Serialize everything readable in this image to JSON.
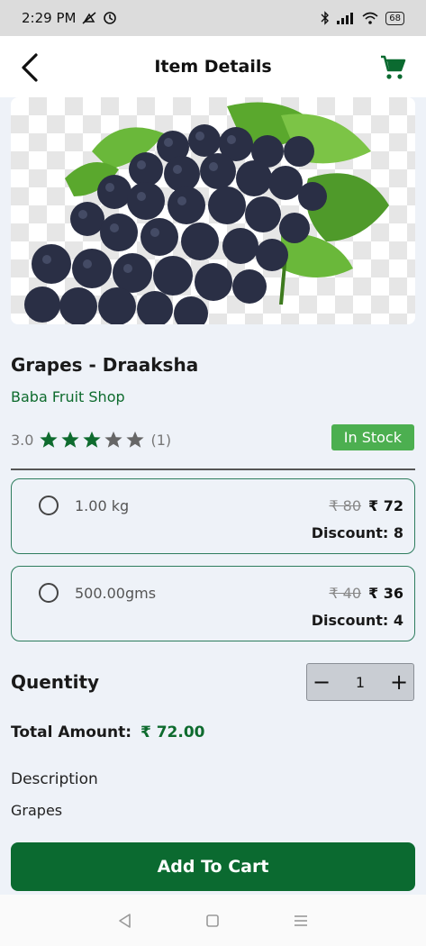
{
  "status_bar": {
    "time": "2:29 PM",
    "battery": "68"
  },
  "header": {
    "title": "Item Details"
  },
  "product": {
    "name": "Grapes - Draaksha",
    "shop": "Baba Fruit Shop",
    "rating": "3.0",
    "stars_filled": 3,
    "stars_total": 5,
    "review_count": "(1)",
    "stock_status": "In Stock"
  },
  "options": [
    {
      "weight": "1.00 kg",
      "old_price": "₹ 80",
      "new_price": "₹ 72",
      "discount": "Discount: 8"
    },
    {
      "weight": "500.00gms",
      "old_price": "₹ 40",
      "new_price": "₹ 36",
      "discount": "Discount: 4"
    }
  ],
  "quantity": {
    "label": "Quentity",
    "value": "1",
    "minus": "−",
    "plus": "+"
  },
  "total": {
    "label": "Total Amount:",
    "amount": "₹ 72.00"
  },
  "description": {
    "title": "Description",
    "text": "Grapes"
  },
  "actions": {
    "add_to_cart": "Add To Cart"
  },
  "colors": {
    "primary_green": "#0b6a30",
    "stock_green": "#4caf50",
    "star": "#0e6b2e",
    "star_empty": "#666666"
  }
}
